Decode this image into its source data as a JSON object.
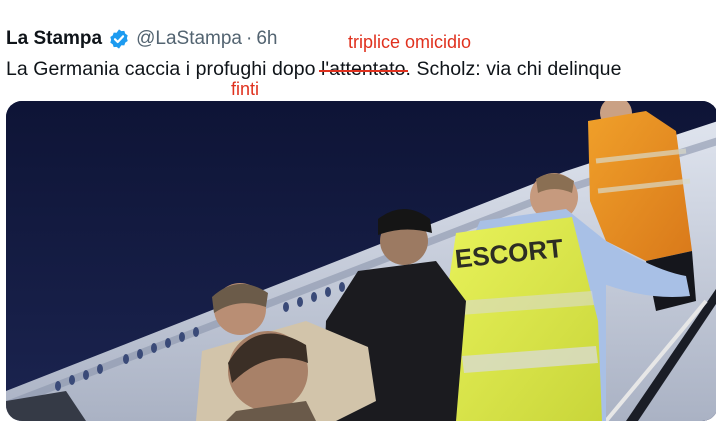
{
  "tweet": {
    "author_name": "La Stampa",
    "handle": "@LaStampa",
    "separator": "·",
    "time": "6h",
    "text_before": "La Germania caccia i profughi dopo ",
    "text_struck": "l'attentato",
    "text_after": ". Scholz: via chi delinque"
  },
  "annotations": {
    "replacement_top": "triplice omicidio",
    "replacement_bottom": "finti"
  },
  "media": {
    "vest_label": "ESCORT"
  },
  "colors": {
    "verified": "#1d9bf0",
    "annotation": "#e0311e",
    "handle": "#536471",
    "night_sky": "#101639"
  },
  "icons": {
    "verified": "verified-badge-icon"
  }
}
